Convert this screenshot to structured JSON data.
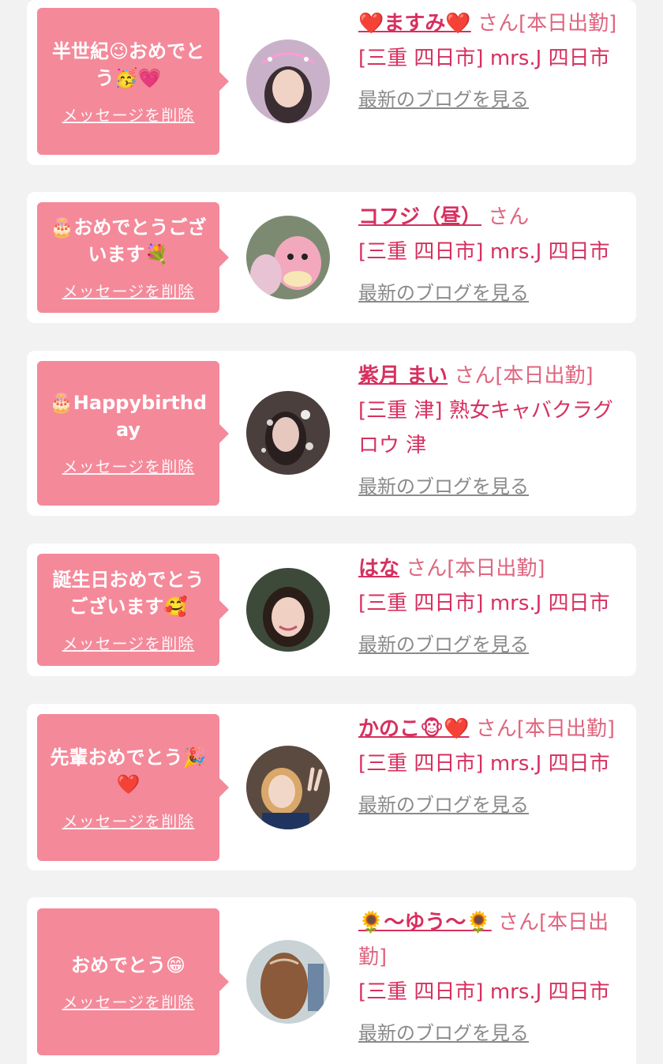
{
  "delete_label": "メッセージを削除",
  "blog_label": "最新のブログを見る",
  "cards": [
    {
      "message": "半世紀😉おめでとう🥳💗",
      "name": "❤️ますみ❤️",
      "suffix": "さん[本日出勤]",
      "shop": "[三重 四日市] mrs.J 四日市",
      "avatar": "woman-selfie-pink-frame-photo"
    },
    {
      "message": "🎂おめでとうございます💐",
      "name": "コフジ（昼）",
      "suffix": "さん",
      "shop": "[三重 四日市] mrs.J 四日市",
      "avatar": "pink-plush-toy-photo"
    },
    {
      "message": "🎂Happybirthday",
      "name": "紫月 まい",
      "suffix": "さん[本日出勤]",
      "shop": "[三重 津] 熟女キャバクラグロウ 津",
      "avatar": "woman-sparkle-photo"
    },
    {
      "message": "誕生日おめでとうございます🥰",
      "name": "はな",
      "suffix": "さん[本日出勤]",
      "shop": "[三重 四日市] mrs.J 四日市",
      "avatar": "woman-smiling-photo"
    },
    {
      "message": "先輩おめでとう🎉❤️",
      "name": "かのこ🐵❤️",
      "suffix": "さん[本日出勤]",
      "shop": "[三重 四日市] mrs.J 四日市",
      "avatar": "woman-peace-sign-photo"
    },
    {
      "message": "おめでとう😁",
      "name": "🌻〜ゆう〜🌻",
      "suffix": "さん[本日出勤]",
      "shop": "[三重 四日市] mrs.J 四日市",
      "avatar": "woman-braided-hair-photo"
    }
  ]
}
